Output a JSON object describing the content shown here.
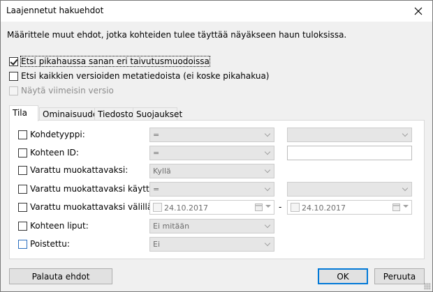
{
  "window": {
    "title": "Laajennetut hakuehdot",
    "close_icon": "close-icon"
  },
  "description": "Määrittele muut ehdot, jotka kohteiden tulee täyttää näyäkseen haun tuloksissa.",
  "options": [
    {
      "label": "Etsi pikahaussa sanan eri taivutusmuodoissa",
      "checked": true,
      "enabled": true
    },
    {
      "label": "Etsi kaikkien versioiden metatiedoista (ei koske pikahakua)",
      "checked": false,
      "enabled": true
    },
    {
      "label": "Näytä viimeisin versio",
      "checked": false,
      "enabled": false
    }
  ],
  "tabs": [
    {
      "label": "Tila",
      "active": true
    },
    {
      "label": "Ominaisuudet",
      "active": false
    },
    {
      "label": "Tiedostot",
      "active": false
    },
    {
      "label": "Suojaukset",
      "active": false
    }
  ],
  "conditions": [
    {
      "label": "Kohdetyyppi:",
      "checked": false,
      "operator": "=",
      "value": ""
    },
    {
      "label": "Kohteen ID:",
      "checked": false,
      "operator": "=",
      "value": ""
    },
    {
      "label": "Varattu muokattavaksi:",
      "checked": false,
      "value": "Kyllä"
    },
    {
      "label": "Varattu muokattavaksi käyttäjälle:",
      "checked": false,
      "operator": "=",
      "value": ""
    },
    {
      "label": "Varattu muokattavaksi välillä:",
      "checked": false,
      "date_from": "24.10.2017",
      "date_separator": "-",
      "date_to": "24.10.2017"
    },
    {
      "label": "Kohteen liput:",
      "checked": false,
      "value": "Ei mitään"
    },
    {
      "label": "Poistettu:",
      "checked": false,
      "value": "Ei"
    }
  ],
  "buttons": {
    "reset": "Palauta ehdot",
    "ok": "OK",
    "cancel": "Peruuta"
  },
  "colors": {
    "accent": "#0078d7",
    "disabled_text": "#8c8c8c",
    "disabled_field": "#e6e6e6"
  }
}
